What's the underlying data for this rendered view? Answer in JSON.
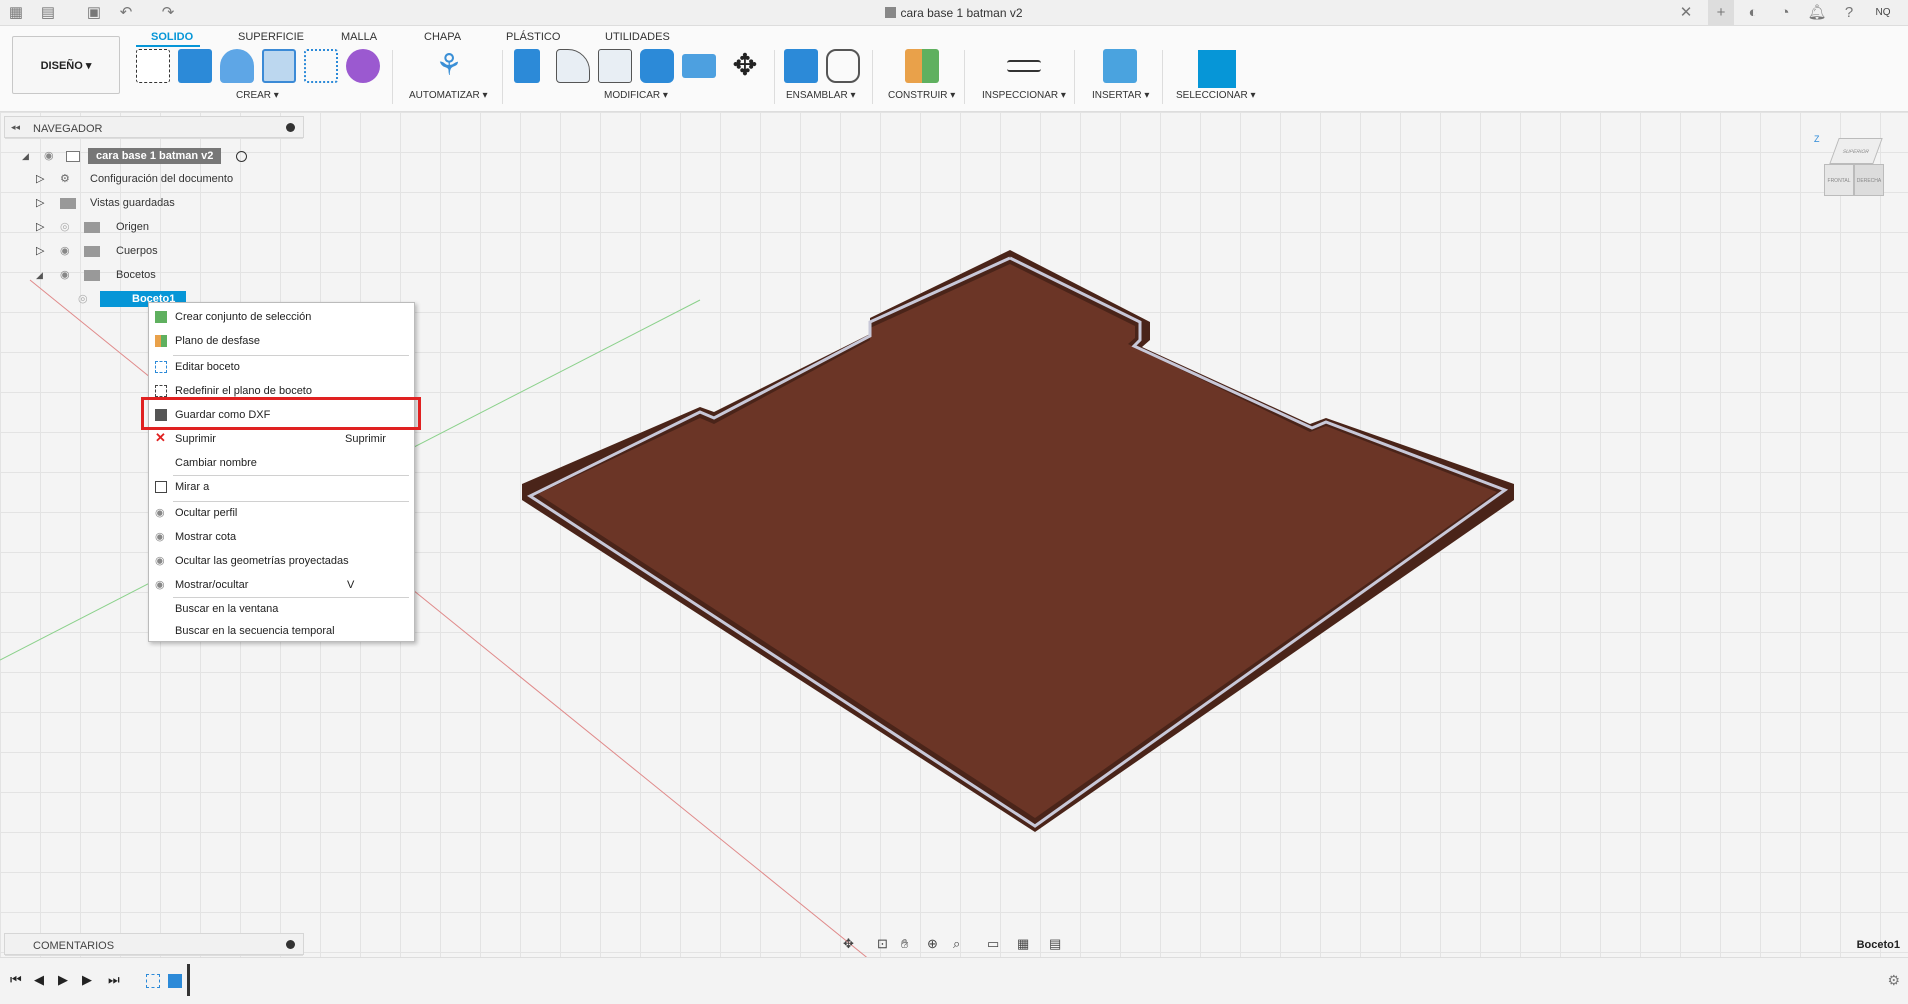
{
  "window": {
    "title": "cara base 1 batman v2",
    "user_initials": "NQ"
  },
  "ribbon": {
    "design_button": "DISEÑO ▾",
    "tabs": [
      "SOLIDO",
      "SUPERFICIE",
      "MALLA",
      "CHAPA",
      "PLÁSTICO",
      "UTILIDADES"
    ],
    "groups": {
      "crear": "CREAR ▾",
      "automatizar": "AUTOMATIZAR ▾",
      "modificar": "MODIFICAR ▾",
      "ensamblar": "ENSAMBLAR ▾",
      "construir": "CONSTRUIR ▾",
      "inspeccionar": "INSPECCIONAR ▾",
      "insertar": "INSERTAR ▾",
      "seleccionar": "SELECCIONAR ▾"
    }
  },
  "navigator": {
    "title": "NAVEGADOR",
    "root": "cara base 1 batman v2",
    "items": [
      "Configuración del documento",
      "Vistas guardadas",
      "Origen",
      "Cuerpos",
      "Bocetos"
    ],
    "selected": "Boceto1"
  },
  "context_menu": {
    "items": [
      {
        "label": "Crear conjunto de selección",
        "shortcut": ""
      },
      {
        "label": "Plano de desfase",
        "shortcut": ""
      },
      {
        "label": "Editar boceto",
        "shortcut": ""
      },
      {
        "label": "Redefinir el plano de boceto",
        "shortcut": ""
      },
      {
        "label": "Guardar como DXF",
        "shortcut": ""
      },
      {
        "label": "Suprimir",
        "shortcut": "Suprimir"
      },
      {
        "label": "Cambiar nombre",
        "shortcut": ""
      },
      {
        "label": "Mirar a",
        "shortcut": ""
      },
      {
        "label": "Ocultar perfil",
        "shortcut": ""
      },
      {
        "label": "Mostrar cota",
        "shortcut": ""
      },
      {
        "label": "Ocultar las geometrías proyectadas",
        "shortcut": ""
      },
      {
        "label": "Mostrar/ocultar",
        "shortcut": "V"
      },
      {
        "label": "Buscar en la ventana",
        "shortcut": ""
      },
      {
        "label": "Buscar en la secuencia temporal",
        "shortcut": ""
      }
    ]
  },
  "comments": {
    "title": "COMENTARIOS"
  },
  "status": {
    "selection": "Boceto1"
  },
  "viewcube": {
    "labels": [
      "SUPERIOR",
      "FRONTAL",
      "DERECHA"
    ],
    "axis": "Z"
  },
  "colors": {
    "accent": "#0696d7",
    "wood": "#5a2e22",
    "highlight": "#e02121"
  }
}
